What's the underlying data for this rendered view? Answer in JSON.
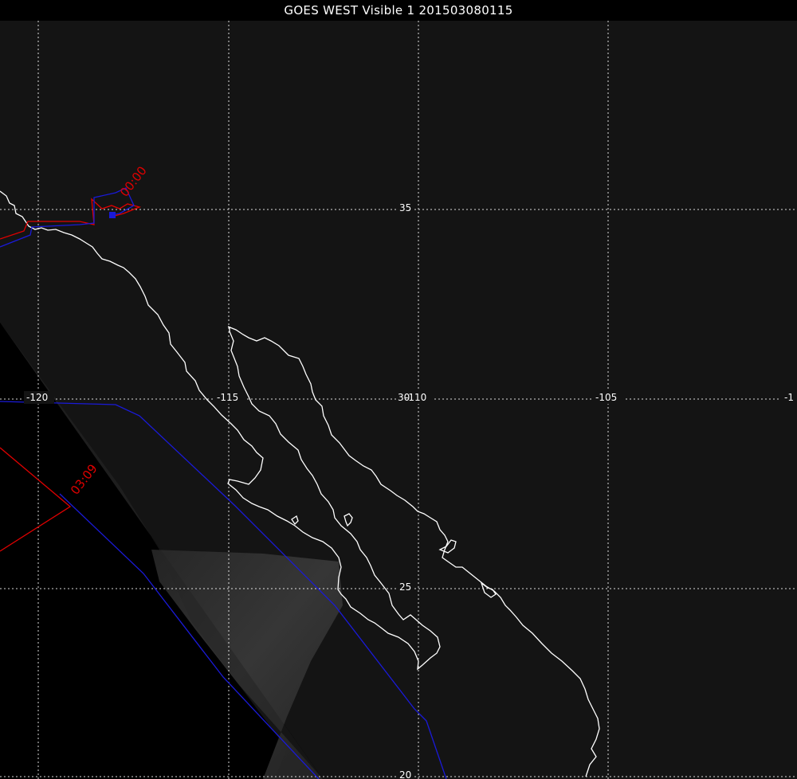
{
  "title": "GOES WEST Visible 1 201503080115",
  "longitude_labels": [
    "-120",
    "-115",
    "-110",
    "-105",
    "-1"
  ],
  "latitude_labels": [
    "35",
    "30",
    "25",
    "20"
  ],
  "track_labels": [
    "00:00",
    "03:09"
  ],
  "colors": {
    "background": "#000000",
    "imagery_lit": "#141414",
    "imagery_bright": "#3a3a3a",
    "grid": "#ffffff",
    "coastline": "#ffffff",
    "track_red": "#e00000",
    "track_blue": "#1a1ad8"
  }
}
